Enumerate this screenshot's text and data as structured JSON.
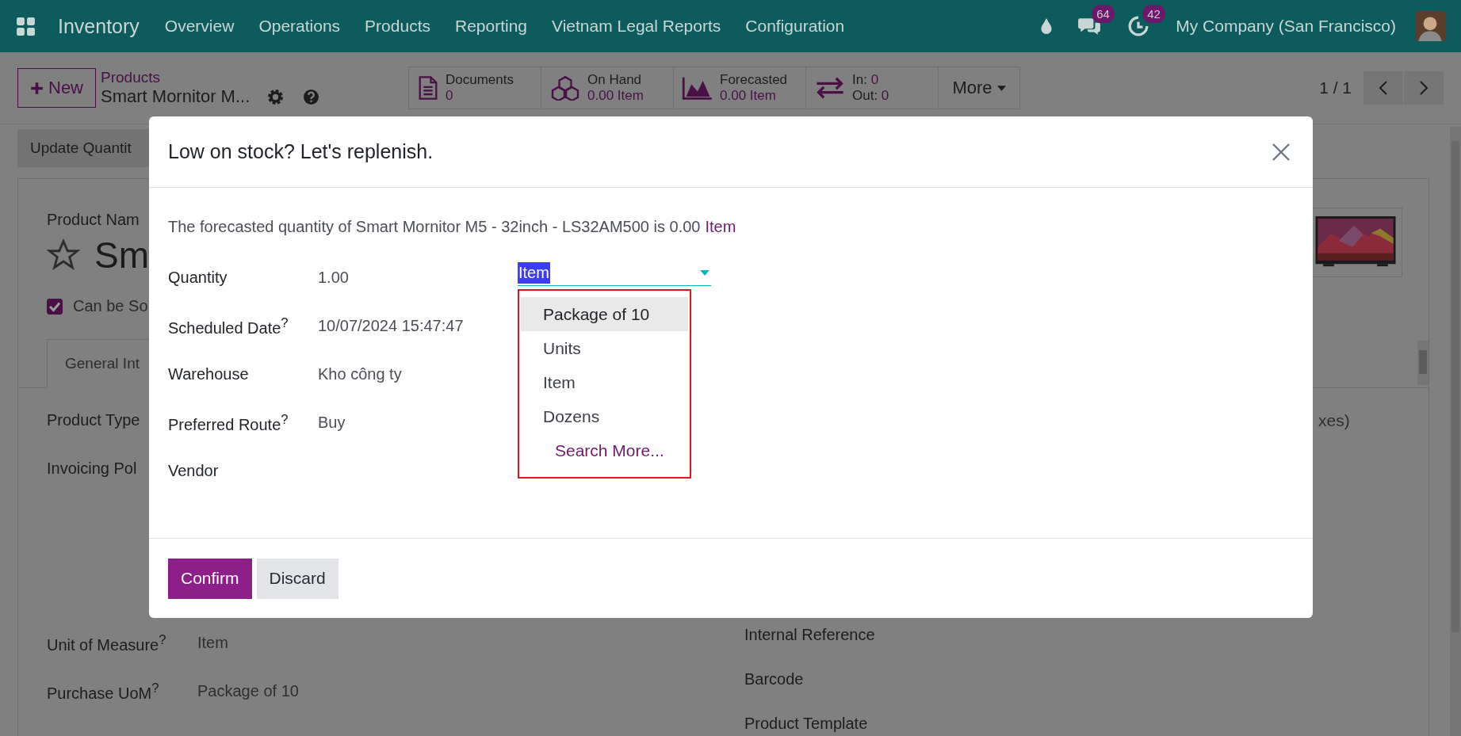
{
  "navbar": {
    "app_name": "Inventory",
    "menu": [
      "Overview",
      "Operations",
      "Products",
      "Reporting",
      "Vietnam Legal Reports",
      "Configuration"
    ],
    "chat_count": "64",
    "activity_count": "42",
    "company": "My Company (San Francisco)"
  },
  "control_panel": {
    "new_button": "New",
    "breadcrumb": "Products",
    "record_name": "Smart Mornitor M...",
    "smart_buttons": [
      {
        "kind": "documents",
        "label": "Documents",
        "value": "0"
      },
      {
        "kind": "on_hand",
        "label": "On Hand",
        "value": "0.00 Item"
      },
      {
        "kind": "forecasted",
        "label": "Forecasted",
        "value": "0.00 Item"
      },
      {
        "kind": "in_out",
        "lines": [
          {
            "label": "In:",
            "value": "0"
          },
          {
            "label": "Out:",
            "value": "0"
          }
        ]
      }
    ],
    "more": "More",
    "pager": "1 / 1"
  },
  "form": {
    "action_button": "Update Quantit",
    "name_label": "Product Nam",
    "title": "Sm",
    "favorite": false,
    "checkbox": {
      "label": "Can be So",
      "checked": true
    },
    "tab": "General Int",
    "left_fields": [
      {
        "label": "Product Type"
      },
      {
        "label": "Invoicing Pol"
      },
      {
        "label": "Unit of Measure$^{?}$",
        "value": "Item"
      },
      {
        "label": "Purchase UoM$^{?}$",
        "value": "Package of 10"
      }
    ],
    "right_fragment": "xes)",
    "right_fields": [
      "Internal Reference",
      "Barcode",
      "Product Template"
    ]
  },
  "dialog": {
    "title": "Low on stock? Let's replenish.",
    "message": "The forecasted quantity of Smart Mornitor M5 - 32inch - LS32AM500 is 0.00",
    "message_link": "Item",
    "fields": [
      {
        "label": "Quantity",
        "value": "1.00"
      },
      {
        "label": "Scheduled Date$^{?}$",
        "value": "10/07/2024 15:47:47"
      },
      {
        "label": "Warehouse",
        "value": "Kho công ty"
      },
      {
        "label": "Preferred Route$^{?}$",
        "value": "Buy"
      },
      {
        "label": "Vendor"
      }
    ],
    "uom": {
      "value": "Item",
      "highlighted": true
    },
    "dropdown": {
      "annotated": true,
      "options": [
        {
          "label": "Package of 10",
          "selected": true
        },
        {
          "label": "Units",
          "selected": false
        },
        {
          "label": "Item",
          "selected": false
        },
        {
          "label": "Dozens",
          "selected": false
        }
      ],
      "search_more": "Search More..."
    },
    "buttons": [
      {
        "label": "Confirm",
        "kind": "primary"
      },
      {
        "label": "Discard",
        "kind": "secondary"
      }
    ]
  }
}
